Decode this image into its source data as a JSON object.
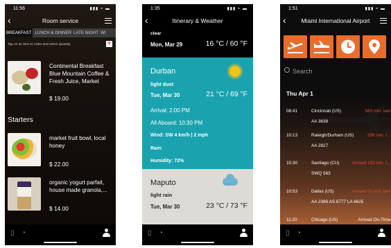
{
  "status": {
    "signal": "▮▮▮ ≈ ▬"
  },
  "phone1": {
    "time": "11:56",
    "title": "Room service",
    "categories": [
      "BREAKFAST",
      "LUNCH & DINNER",
      "LATE NIGHT",
      "WI"
    ],
    "hint": "Tap on an item to order and select quantity",
    "items": [
      {
        "name": "Continental Breakfast Blue Mountain Coffee & Fresh Juice, Market",
        "price": "$ 19.00"
      },
      {
        "name": "market fruit bowl, local honey",
        "price": "$ 22.00"
      },
      {
        "name": "organic yogurt parfait, house made granola,...",
        "price": "$ 14.00"
      }
    ],
    "section": "Starters"
  },
  "phone2": {
    "time": "1:35",
    "title": "Itinerary & Weather",
    "previous": {
      "condition": "clear",
      "date": "Mon, Mar 29",
      "temp": "16 °C / 60 °F"
    },
    "current": {
      "city": "Durban",
      "condition": "light dust",
      "date": "Tue, Mar 30",
      "temp": "21 °C / 69 °F",
      "arrival": "Arrival: 2:00 PM",
      "aboard": "All Aboard: 10:30 PM",
      "wind": "Wind: SW 4 km/h  |  2 mph",
      "rain": "Rain:",
      "humidity": "Humidity: 72%"
    },
    "next": {
      "city": "Maputo",
      "condition": "light rain",
      "date": "Tue, Mar 30",
      "temp": "23 °C / 73 °F"
    }
  },
  "phone3": {
    "time": "1:51",
    "title": "Miami International Airport",
    "icons": [
      "departures-icon",
      "arrivals-icon",
      "clock-icon",
      "location-pin-icon"
    ],
    "accent": "#e86d2c",
    "search_placeholder": "Search",
    "day": "Thu Apr 1",
    "flights": [
      {
        "time": "08:41",
        "city": "Cincinnati (US)",
        "status": "583 min. late",
        "numbers": "AA 3638"
      },
      {
        "time": "10:13",
        "city": "Raleigh/Durham (US)",
        "status": "298 min. l...",
        "numbers": "AA 2827"
      },
      {
        "time": "10:30",
        "city": "Santiago (CU)",
        "status": "Arrived 102 min. l...",
        "numbers": "SWQ 563"
      },
      {
        "time": "10:53",
        "city": "Dallas (US)",
        "status": "Arrived 51 min. late",
        "numbers": "AA 2386  AS 6777  LA 6625"
      },
      {
        "time": "11:20",
        "city": "Chicago (US)",
        "status": "Arrived On-Time",
        "numbers": ""
      }
    ]
  }
}
